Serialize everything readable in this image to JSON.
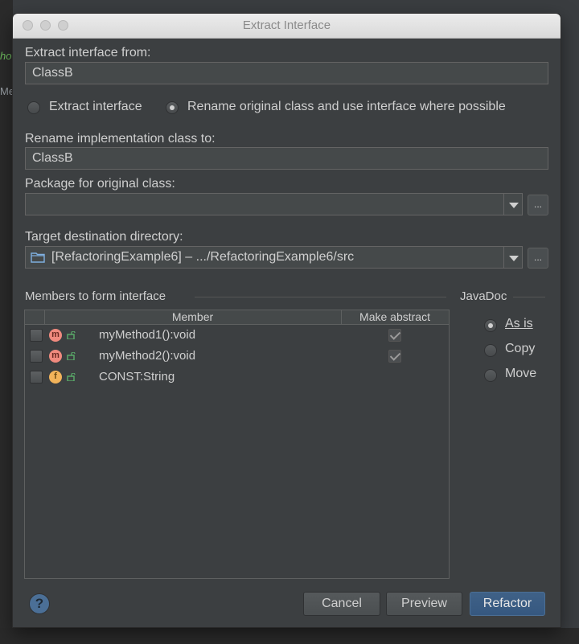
{
  "background": {
    "snippet1": "ho",
    "snippet2": "Me"
  },
  "window": {
    "title": "Extract Interface"
  },
  "extract_from": {
    "label": "Extract interface from:",
    "value": "ClassB"
  },
  "mode": {
    "option1": "Extract interface",
    "option2": "Rename original class and use interface where possible",
    "selected": "option2"
  },
  "rename": {
    "label": "Rename implementation class to:",
    "value": "ClassB"
  },
  "package": {
    "label": "Package for original class:",
    "value": "",
    "browse": "..."
  },
  "target": {
    "label": "Target destination directory:",
    "value": "[RefactoringExample6] – .../RefactoringExample6/src",
    "browse": "..."
  },
  "members": {
    "title": "Members to form interface",
    "columns": {
      "member": "Member",
      "abstract": "Make abstract"
    },
    "rows": [
      {
        "icon": "m",
        "name": "myMethod1():void",
        "checked": false,
        "make_abstract": true
      },
      {
        "icon": "m",
        "name": "myMethod2():void",
        "checked": false,
        "make_abstract": true
      },
      {
        "icon": "f",
        "name": "CONST:String",
        "checked": false,
        "make_abstract": false
      }
    ]
  },
  "javadoc": {
    "title": "JavaDoc",
    "options": [
      "As is",
      "Copy",
      "Move"
    ],
    "selected": "As is"
  },
  "buttons": {
    "help": "?",
    "cancel": "Cancel",
    "preview": "Preview",
    "refactor": "Refactor"
  },
  "colors": {
    "dialog_bg": "#3c3f41",
    "primary_button": "#365880",
    "method_icon": "#f08a7e",
    "field_icon": "#f2b35a",
    "lock_green": "#59a869"
  }
}
